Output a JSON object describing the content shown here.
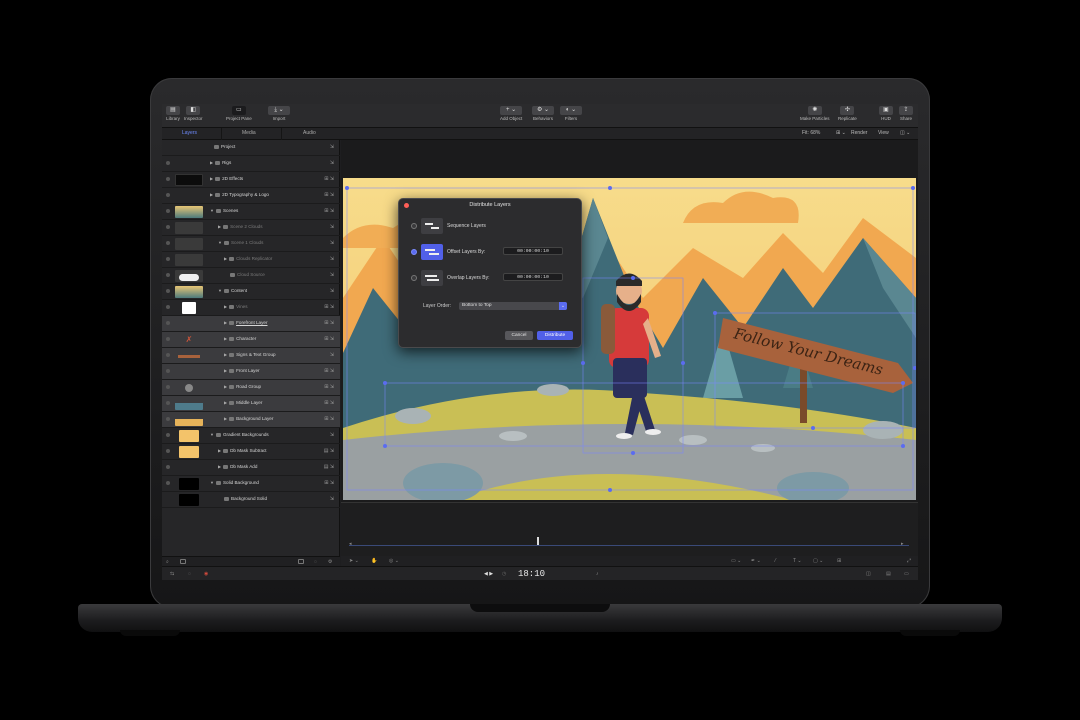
{
  "toolbar": {
    "library": "Library",
    "inspector": "Inspector",
    "project_pane": "Project Pane",
    "import": "Import",
    "add_object": "Add Object",
    "behaviors": "Behaviors",
    "filters": "Filters",
    "make_particles": "Make Particles",
    "replicate": "Replicate",
    "hud": "HUD",
    "share": "Share"
  },
  "tabs": {
    "layers": "Layers",
    "media": "Media",
    "audio": "Audio"
  },
  "view_options": {
    "fit": "Fit: 68%",
    "render": "Render",
    "view": "View"
  },
  "layers": [
    {
      "label": "Project"
    },
    {
      "label": "Rigs"
    },
    {
      "label": "2D Effects"
    },
    {
      "label": "2D Typography & Logo"
    },
    {
      "label": "Scenes"
    },
    {
      "label": "Scene 2 Clouds"
    },
    {
      "label": "Scene 1 Clouds"
    },
    {
      "label": "Clouds Replicator"
    },
    {
      "label": "Cloud Source"
    },
    {
      "label": "Content"
    },
    {
      "label": "Vines"
    },
    {
      "label": "Forefront Layer"
    },
    {
      "label": "Character"
    },
    {
      "label": "Signs & Text Group"
    },
    {
      "label": "Front Layer"
    },
    {
      "label": "Road Group"
    },
    {
      "label": "Middle Layer"
    },
    {
      "label": "Background Layer"
    },
    {
      "label": "Gradient Backgrounds"
    },
    {
      "label": "Db Mask Subtract"
    },
    {
      "label": "Db Mask Add"
    },
    {
      "label": "Solid Background"
    },
    {
      "label": "Background Solid"
    }
  ],
  "dialog": {
    "title": "Distribute Layers",
    "option_sequence": "Sequence Layers",
    "option_offset": "Offset Layers By:",
    "option_overlap": "Overlap Layers By:",
    "offset_value": "00:00:00:10",
    "overlap_value": "00:00:00:10",
    "layer_order_label": "Layer Order:",
    "layer_order_value": "Bottom to Top",
    "cancel": "Cancel",
    "distribute": "Distribute"
  },
  "scene": {
    "sign_text": "Follow Your Dreams"
  },
  "playback": {
    "timecode": "18:10"
  },
  "colors": {
    "accent": "#5160e8",
    "sky": "#f6d783",
    "mountain": "#3f6b78",
    "grass": "#c9bf55"
  }
}
